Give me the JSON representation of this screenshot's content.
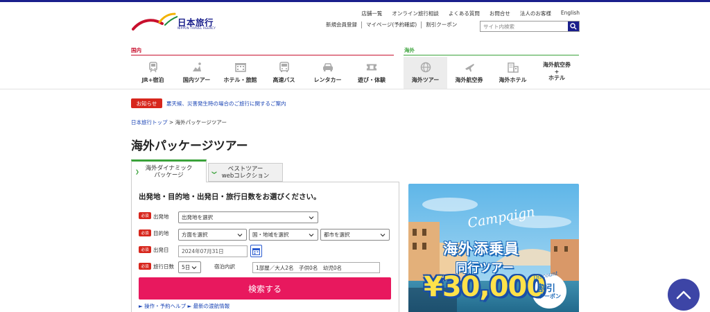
{
  "brand": {
    "name": "日本旅行",
    "sub": "NIPPON TRAVEL AGENCY",
    "color": "#1a1f8c"
  },
  "utility_nav": [
    "店舗一覧",
    "オンライン旅行相談",
    "よくある質問",
    "お問合せ",
    "法人のお客様",
    "English"
  ],
  "sub_nav": [
    "新規会員登録",
    "マイページ(予約確認)",
    "割引クーポン"
  ],
  "search": {
    "placeholder": "サイト内検索",
    "icon": "search-icon"
  },
  "categories": {
    "domestic_label": "国内",
    "overseas_label": "海外",
    "domestic_color": "#c8102e",
    "overseas_color": "#3aa23a",
    "domestic": [
      {
        "label": "JR+宿泊",
        "icon": "train-icon"
      },
      {
        "label": "国内ツアー",
        "icon": "sightseeing-icon"
      },
      {
        "label": "ホテル・旅館",
        "icon": "hotel-icon"
      },
      {
        "label": "高速バス",
        "icon": "bus-icon"
      },
      {
        "label": "レンタカー",
        "icon": "car-icon"
      },
      {
        "label": "遊び・体験",
        "icon": "ticket-icon"
      }
    ],
    "overseas": [
      {
        "label": "海外ツアー",
        "icon": "globe-icon"
      },
      {
        "label": "海外航空券",
        "icon": "airplane-icon"
      },
      {
        "label": "海外ホテル",
        "icon": "building-icon"
      },
      {
        "label_line1": "海外航空券",
        "label_line2": "+",
        "label_line3": "ホテル"
      }
    ]
  },
  "notice": {
    "badge": "お知らせ",
    "text": "悪天候、災害発生時の場合のご旅行に関するご案内"
  },
  "breadcrumb": {
    "home": "日本旅行トップ",
    "separator": ">",
    "current": "海外パッケージツアー"
  },
  "page_title": "海外パッケージツアー",
  "tabs": [
    {
      "line1": "海外ダイナミック",
      "line2": "パッケージ",
      "active": true
    },
    {
      "line1": "ベストツアー",
      "line2": "webコレクション",
      "active": false
    }
  ],
  "form": {
    "title": "出発地・目的地・出発日・旅行日数をお選びください。",
    "required_badge": "必須",
    "departure": {
      "label": "出発地",
      "value": "出発地を選択"
    },
    "destination": {
      "label": "目的地",
      "direction": "方面を選択",
      "country": "国・地域を選択",
      "city": "都市を選択"
    },
    "date": {
      "label": "出発日",
      "value": "2024年07月31日"
    },
    "duration": {
      "label": "旅行日数",
      "value": "5日"
    },
    "guests": {
      "label": "宿泊内訳",
      "value": "1部屋／大人2名　子供0名　幼児0名"
    },
    "submit": "検索する",
    "help_links": "► 操作・予約ヘルプ ► 最新の渡航情報"
  },
  "banner": {
    "campaign": "Campaign",
    "main": "海外添乗員",
    "sub": "同行ツアー",
    "amount": "¥30,000",
    "discount": "Discount",
    "coupon1": "割引",
    "coupon2": "クーポン"
  }
}
